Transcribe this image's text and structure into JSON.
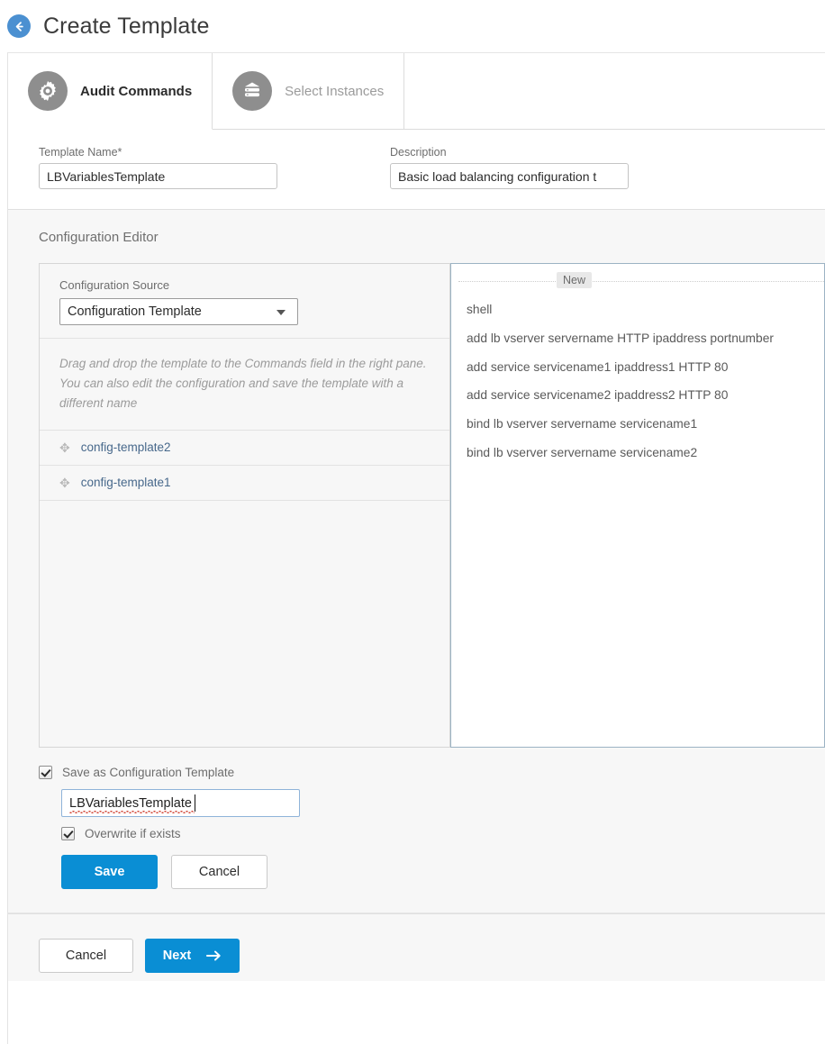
{
  "header": {
    "back_icon": "back-arrow-icon",
    "title": "Create Template"
  },
  "tabs": [
    {
      "label": "Audit Commands",
      "icon": "gear-icon",
      "active": true
    },
    {
      "label": "Select Instances",
      "icon": "server-stack-icon",
      "active": false
    }
  ],
  "fields": {
    "template_name_label": "Template Name*",
    "template_name_value": "LBVariablesTemplate",
    "description_label": "Description",
    "description_value": "Basic load balancing configuration t"
  },
  "editor": {
    "title": "Configuration Editor",
    "source_label": "Configuration Source",
    "source_value": "Configuration Template",
    "hint": "Drag and drop the template to the Commands field in the right pane. You can also edit the configuration and save the template with a different name",
    "templates": [
      {
        "name": "config-template2",
        "handle": "drag-handle-icon"
      },
      {
        "name": "config-template1",
        "handle": "drag-handle-icon"
      }
    ],
    "commands_badge": "New",
    "commands": [
      "shell",
      "add lb vserver servername HTTP ipaddress portnumber",
      "add service servicename1 ipaddress1 HTTP 80",
      "add service servicename2 ipaddress2 HTTP 80",
      "bind lb vserver servername servicename1",
      "bind lb vserver servername servicename2"
    ]
  },
  "save_section": {
    "save_as_label": "Save as Configuration Template",
    "save_as_checked": true,
    "template_name_value": "LBVariablesTemplate",
    "overwrite_label": "Overwrite if exists",
    "overwrite_checked": true,
    "save_button": "Save",
    "cancel_button": "Cancel"
  },
  "footer": {
    "cancel_button": "Cancel",
    "next_button": "Next",
    "next_icon": "arrow-right-icon"
  },
  "colors": {
    "accent": "#0a8ed4",
    "back_button": "#4b90d1",
    "link": "#47688b",
    "panel_bg": "#f7f7f7"
  }
}
